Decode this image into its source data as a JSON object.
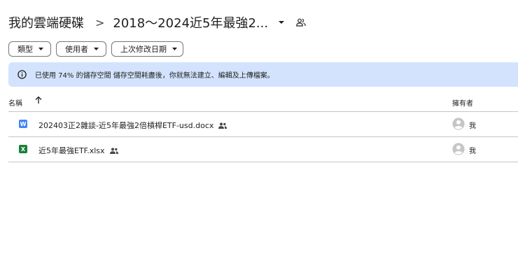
{
  "breadcrumb": {
    "root": "我的雲端硬碟",
    "separator": ">",
    "current": "2018～2024近5年最強2..."
  },
  "filters": [
    {
      "label": "類型"
    },
    {
      "label": "使用者"
    },
    {
      "label": "上次修改日期"
    }
  ],
  "banner": {
    "text": "已使用 74% 的儲存空間 儲存空間耗盡後，你就無法建立、編輯及上傳檔案。"
  },
  "table": {
    "headers": {
      "name": "名稱",
      "owner": "擁有者"
    },
    "rows": [
      {
        "icon_letter": "W",
        "name": "202403正2雜談-近5年最強2倍槓桿ETF-usd.docx",
        "owner": "我",
        "type": "docx"
      },
      {
        "icon_letter": "X",
        "name": "近5年最強ETF.xlsx",
        "owner": "我",
        "type": "xlsx"
      }
    ]
  },
  "icons": {
    "dropdown": "caret-down-icon",
    "share": "people-icon",
    "info": "info-icon",
    "sort": "arrow-up-icon",
    "avatar": "account-circle-icon"
  },
  "colors": {
    "banner_bg": "#d3e3fd",
    "docx": "#4285f4",
    "xlsx": "#188038"
  }
}
